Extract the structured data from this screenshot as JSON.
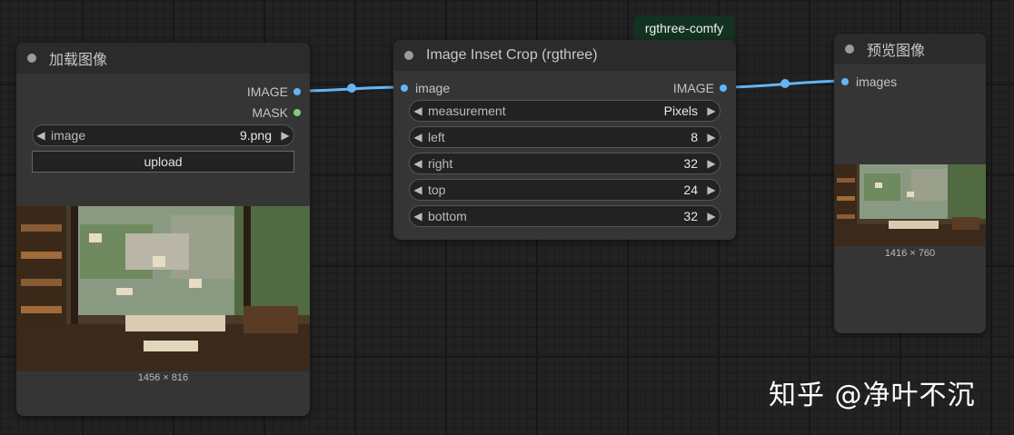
{
  "badge": "rgthree-comfy",
  "load_node": {
    "title": "加载图像",
    "outputs": [
      "IMAGE",
      "MASK"
    ],
    "image_widget": {
      "label": "image",
      "value": "9.png"
    },
    "upload_label": "upload",
    "preview_dims": "1456 × 816"
  },
  "crop_node": {
    "title": "Image Inset Crop (rgthree)",
    "input": "image",
    "output": "IMAGE",
    "widgets": [
      {
        "label": "measurement",
        "value": "Pixels"
      },
      {
        "label": "left",
        "value": "8"
      },
      {
        "label": "right",
        "value": "32"
      },
      {
        "label": "top",
        "value": "24"
      },
      {
        "label": "bottom",
        "value": "32"
      }
    ]
  },
  "preview_node": {
    "title": "预览图像",
    "input": "images",
    "preview_dims": "1416 × 760"
  },
  "watermark": "知乎 @净叶不沉",
  "colors": {
    "link": "#64b5f6",
    "mask_slot": "#7ccf7c",
    "badge_bg": "#123322"
  }
}
